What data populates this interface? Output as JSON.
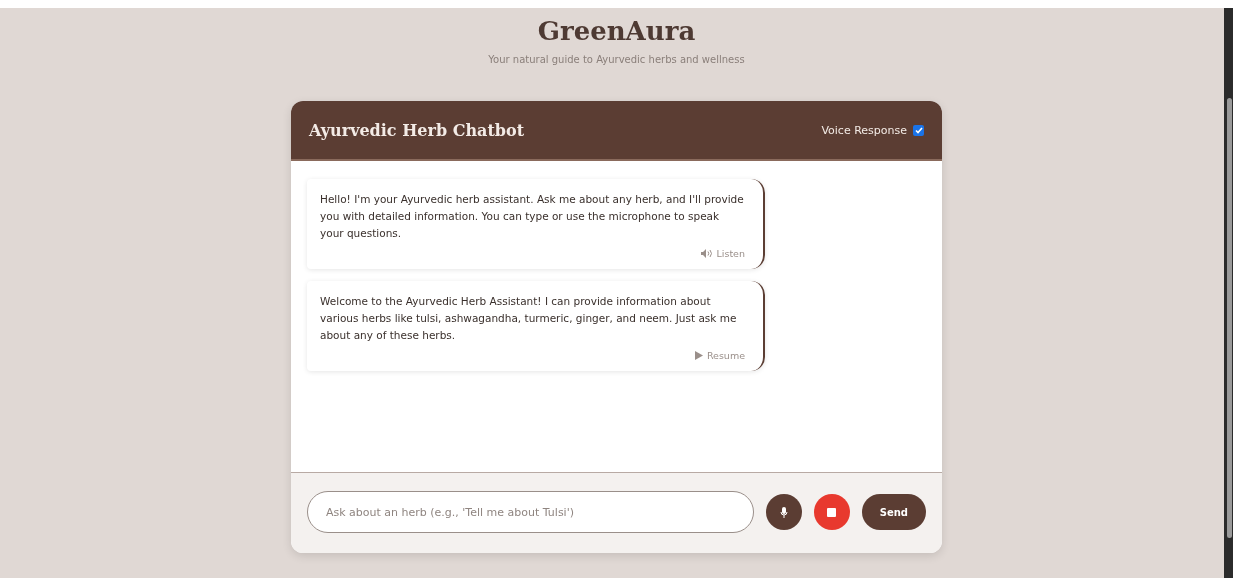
{
  "header": {
    "title": "GreenAura",
    "subtitle": "Your natural guide to Ayurvedic herbs and wellness"
  },
  "chat": {
    "title": "Ayurvedic Herb Chatbot",
    "voice_response": {
      "label": "Voice Response",
      "checked": true
    },
    "messages": [
      {
        "text": "Hello! I'm your Ayurvedic herb assistant. Ask me about any herb, and I'll provide you with detailed information. You can type or use the microphone to speak your questions.",
        "action": {
          "kind": "listen",
          "label": "Listen"
        }
      },
      {
        "text": "Welcome to the Ayurvedic Herb Assistant! I can provide information about various herbs like tulsi, ashwagandha, turmeric, ginger, and neem. Just ask me about any of these herbs.",
        "action": {
          "kind": "resume",
          "label": "Resume"
        }
      }
    ],
    "input": {
      "placeholder": "Ask about an herb (e.g., 'Tell me about Tulsi')"
    },
    "send_label": "Send"
  }
}
